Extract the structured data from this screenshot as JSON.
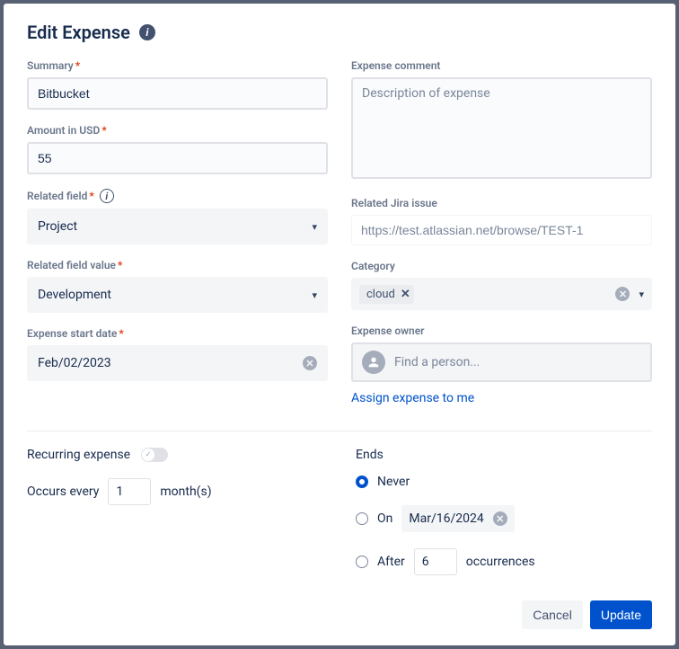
{
  "header": {
    "title": "Edit Expense"
  },
  "left": {
    "summary": {
      "label": "Summary",
      "value": "Bitbucket"
    },
    "amount": {
      "label": "Amount in USD",
      "value": "55"
    },
    "relatedField": {
      "label": "Related field",
      "value": "Project"
    },
    "relatedFieldValue": {
      "label": "Related field value",
      "value": "Development"
    },
    "startDate": {
      "label": "Expense start date",
      "value": "Feb/02/2023"
    }
  },
  "right": {
    "comment": {
      "label": "Expense comment",
      "placeholder": "Description of expense"
    },
    "jira": {
      "label": "Related Jira issue",
      "placeholder": "https://test.atlassian.net/browse/TEST-1"
    },
    "category": {
      "label": "Category",
      "tag": "cloud"
    },
    "owner": {
      "label": "Expense owner",
      "placeholder": "Find a person...",
      "assign_link": "Assign expense to me"
    }
  },
  "recurring": {
    "label": "Recurring expense",
    "occurs_prefix": "Occurs every",
    "occurs_value": "1",
    "occurs_suffix": "month(s)"
  },
  "ends": {
    "label": "Ends",
    "never": "Never",
    "on_label": "On",
    "on_date": "Mar/16/2024",
    "after_label": "After",
    "after_value": "6",
    "after_suffix": "occurrences"
  },
  "footer": {
    "cancel": "Cancel",
    "update": "Update"
  }
}
